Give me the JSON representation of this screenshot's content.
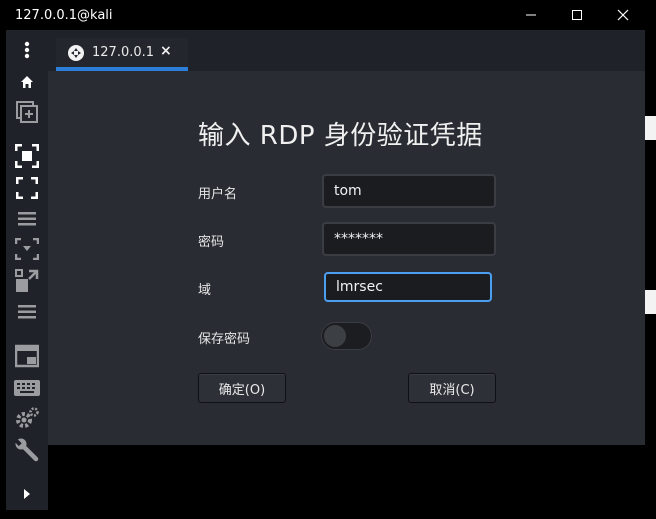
{
  "window": {
    "title": "127.0.0.1@kali",
    "controls": {
      "minimize_icon": "minimize-icon",
      "maximize_icon": "maximize-icon",
      "close_icon": "close-icon"
    }
  },
  "sidebar": {
    "items": [
      {
        "icon": "more-vertical-icon"
      },
      {
        "icon": "home-icon"
      },
      {
        "icon": "new-connection-icon"
      },
      {
        "icon": "focus-icon"
      },
      {
        "icon": "fullscreen-icon"
      },
      {
        "icon": "menu-icon"
      },
      {
        "icon": "scale-icon"
      },
      {
        "icon": "resize-icon"
      },
      {
        "icon": "menu-icon"
      },
      {
        "icon": "screenshot-icon"
      },
      {
        "icon": "keyboard-icon"
      },
      {
        "icon": "settings-icon"
      },
      {
        "icon": "wrench-icon"
      },
      {
        "icon": "expand-arrow-icon"
      }
    ]
  },
  "tab": {
    "label": "127.0.0.1",
    "close": "×",
    "icon": "remmina-icon"
  },
  "dialog": {
    "title": "输入 RDP 身份验证凭据",
    "username_label": "用户名",
    "username_value": "tom",
    "password_label": "密码",
    "password_value": "*******",
    "domain_label": "域",
    "domain_value": "lmrsec",
    "save_password_label": "保存密码",
    "save_password_on": false,
    "ok_label": "确定(O)",
    "cancel_label": "取消(C)"
  },
  "colors": {
    "accent": "#2b7fd8",
    "focus_border": "#4c9ef0",
    "background": "#292c33"
  }
}
